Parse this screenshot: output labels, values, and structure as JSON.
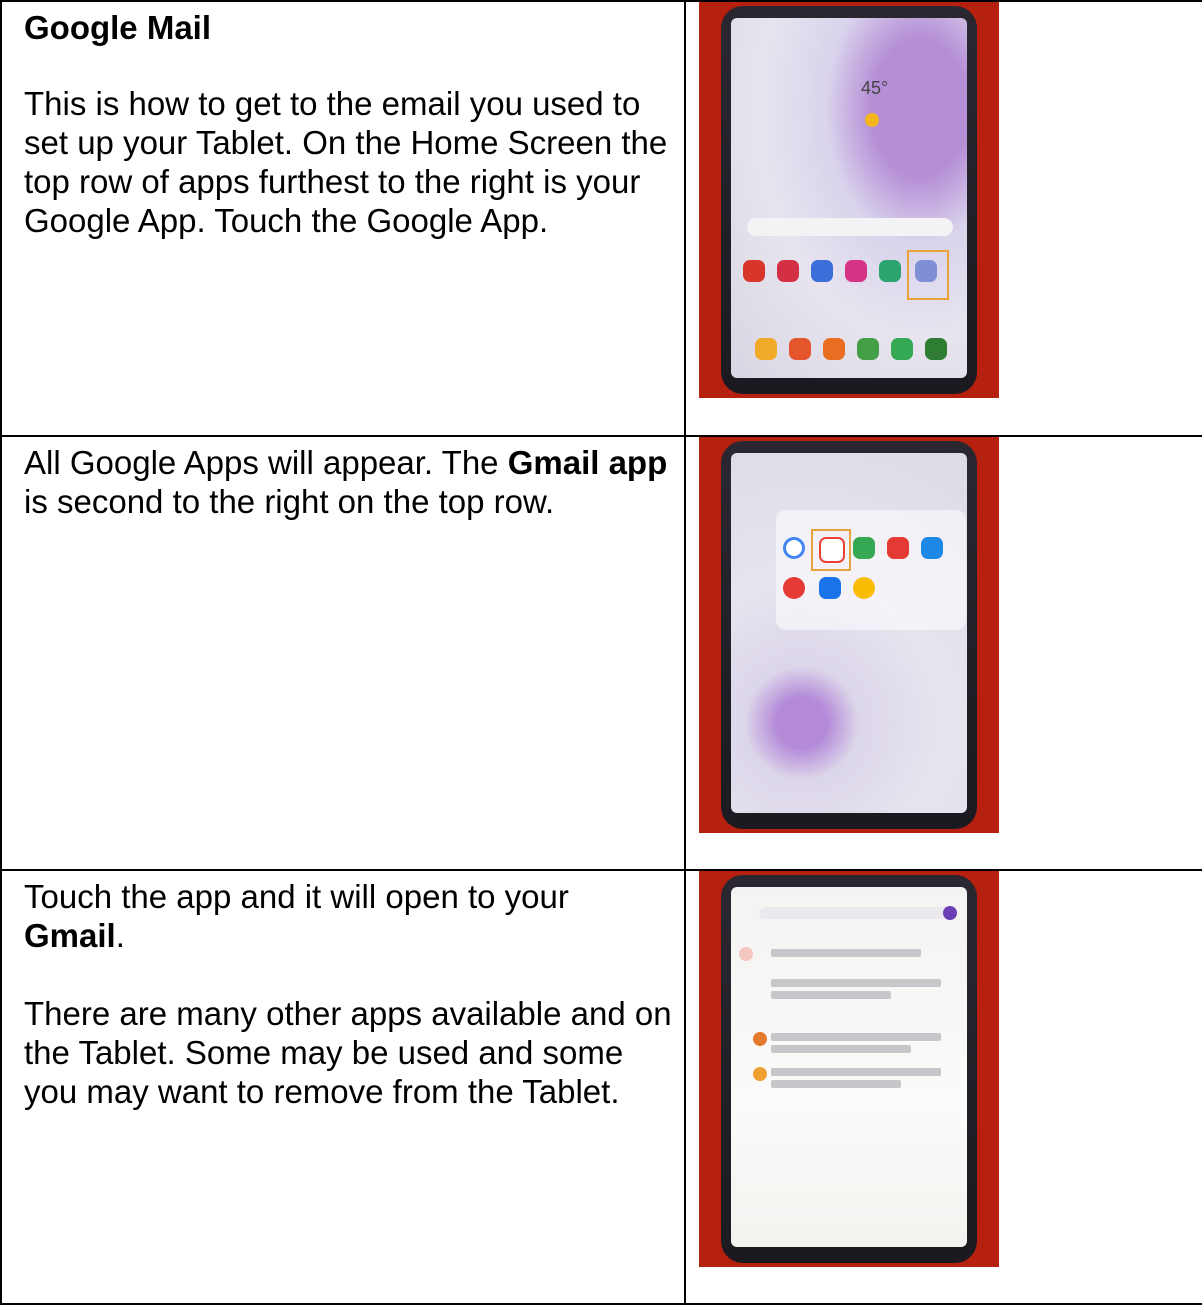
{
  "rows": [
    {
      "title": "Google Mail",
      "paragraphs": [
        [
          {
            "text": "This is how to get to the email you used to set up your Tablet. On the Home Screen the top row of apps furthest to the right is your Google App. Touch the Google App.",
            "bold": false
          }
        ]
      ],
      "photo": {
        "description_icon": "tablet-home-screen-photo",
        "weather_temp": "45°"
      }
    },
    {
      "title": "",
      "paragraphs": [
        [
          {
            "text": "All Google Apps will appear. The ",
            "bold": false
          },
          {
            "text": "Gmail app",
            "bold": true
          },
          {
            "text": " is second to the right on the top row.",
            "bold": false
          }
        ]
      ],
      "photo": {
        "description_icon": "tablet-google-apps-photo"
      }
    },
    {
      "title": "",
      "paragraphs": [
        [
          {
            "text": "Touch the app and it will open to your ",
            "bold": false
          },
          {
            "text": "Gmail",
            "bold": true
          },
          {
            "text": ".",
            "bold": false
          }
        ],
        [
          {
            "text": "There are many other apps available and on the Tablet. Some may be used and some you may want to remove from the Tablet.",
            "bold": false
          }
        ]
      ],
      "photo": {
        "description_icon": "tablet-gmail-inbox-photo"
      }
    }
  ],
  "colors": {
    "photo_background": "#b5200f",
    "highlight": "#e8a33a"
  }
}
